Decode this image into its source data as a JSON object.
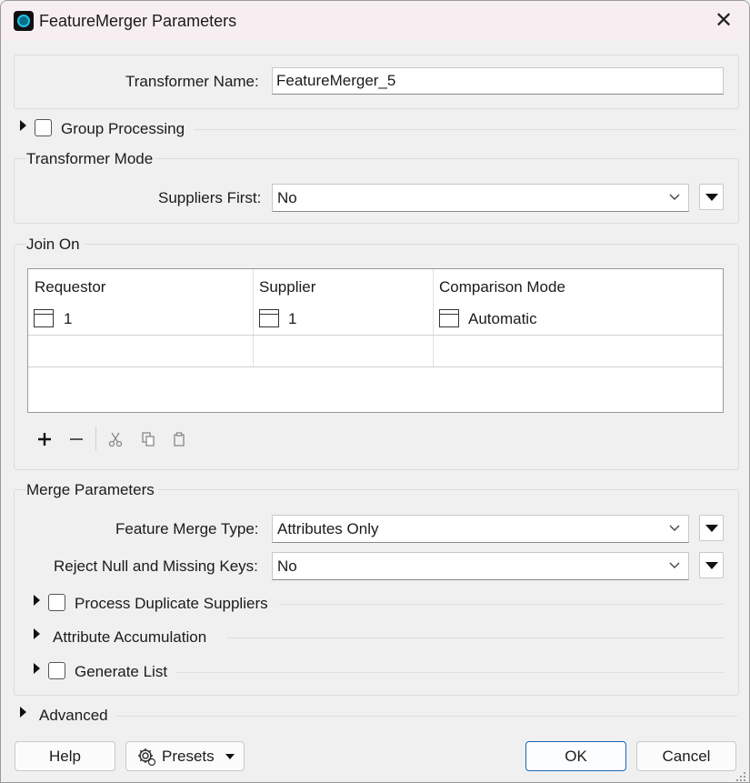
{
  "window": {
    "title": "FeatureMerger Parameters"
  },
  "transformer_name": {
    "label": "Transformer Name:",
    "value": "FeatureMerger_5"
  },
  "group_processing": {
    "label": "Group Processing"
  },
  "transformer_mode": {
    "title": "Transformer Mode",
    "suppliers_first": {
      "label": "Suppliers First:",
      "value": "No"
    }
  },
  "join_on": {
    "title": "Join On",
    "columns": [
      "Requestor",
      "Supplier",
      "Comparison Mode"
    ],
    "rows": [
      {
        "requestor": "1",
        "supplier": "1",
        "mode": "Automatic"
      }
    ]
  },
  "merge_parameters": {
    "title": "Merge Parameters",
    "feature_merge_type": {
      "label": "Feature Merge Type:",
      "value": "Attributes Only"
    },
    "reject_null": {
      "label": "Reject Null and Missing Keys:",
      "value": "No"
    },
    "process_duplicate_suppliers": {
      "label": "Process Duplicate Suppliers"
    },
    "attribute_accumulation": {
      "label": "Attribute Accumulation"
    },
    "generate_list": {
      "label": "Generate List"
    }
  },
  "advanced": {
    "label": "Advanced"
  },
  "buttons": {
    "help": "Help",
    "presets": "Presets",
    "ok": "OK",
    "cancel": "Cancel"
  }
}
